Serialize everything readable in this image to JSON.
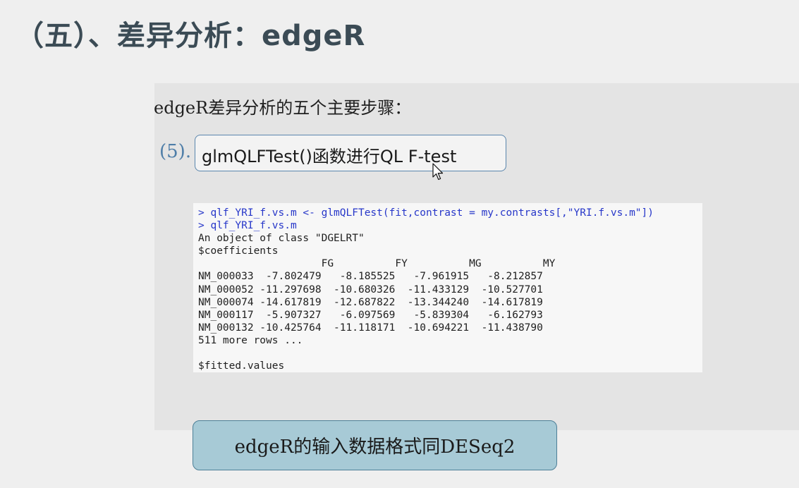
{
  "slide": {
    "title": "（五）、差异分析：edgeR"
  },
  "content": {
    "intro": "edgeR差异分析的五个主要步骤：",
    "step": {
      "number": "(5).",
      "label": "glmQLFTest()函数进行QL F-test"
    },
    "code": {
      "lines": [
        "> qlf_YRI_f.vs.m <- glmQLFTest(fit,contrast = my.contrasts[,\"YRI.f.vs.m\"])",
        "> qlf_YRI_f.vs.m",
        "An object of class \"DGELRT\"",
        "$coefficients",
        "                    FG          FY          MG          MY",
        "NM_000033  -7.802479   -8.185525   -7.961915   -8.212857",
        "NM_000052 -11.297698  -10.680326  -11.433129  -10.527701",
        "NM_000074 -14.617819  -12.687822  -13.344240  -14.617819",
        "NM_000117  -5.907327   -6.097569   -5.839304   -6.162793",
        "NM_000132 -10.425764  -11.118171  -10.694221  -11.438790",
        "511 more rows ...",
        "",
        "$fitted.values"
      ]
    },
    "note": "edgeR的输入数据格式同DESeq2"
  },
  "colors": {
    "title": "#3b4b55",
    "step_number": "#4f7ea8",
    "step_border": "#5a86ad",
    "code_command": "#2737c9",
    "note_background": "#a7cad6"
  },
  "icons": {
    "cursor": "mouse-pointer-icon"
  }
}
